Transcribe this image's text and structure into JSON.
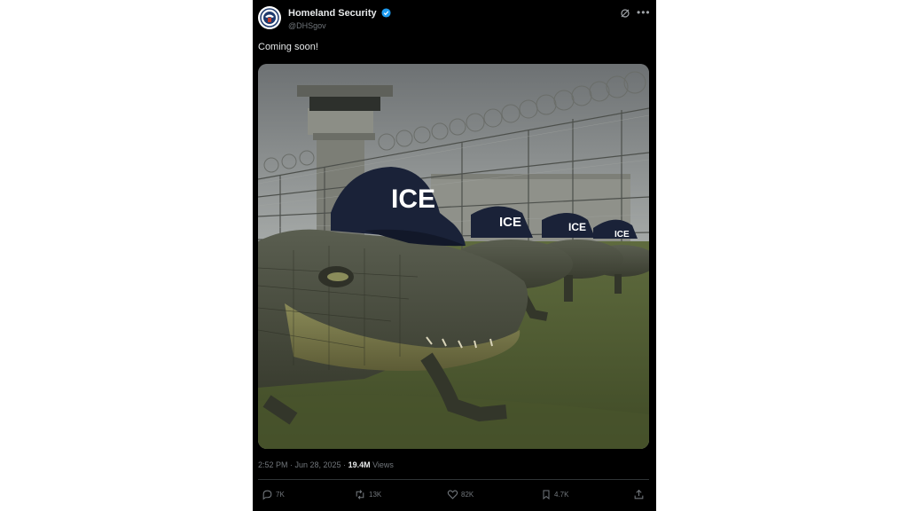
{
  "author": {
    "name": "Homeland Security",
    "handle": "@DHSgov",
    "verified": true,
    "avatar_icon": "dhs-seal-icon"
  },
  "tweet": {
    "text": "Coming soon!",
    "image": {
      "description_icon": "alligators-in-ice-caps-image",
      "hat_label": "ICE"
    }
  },
  "meta": {
    "time": "2:52 PM · Jun 28, 2025 · ",
    "views": "19.4M",
    "views_label": " Views"
  },
  "actions": {
    "replies": "7K",
    "reposts": "13K",
    "likes": "82K",
    "bookmarks": "4.7K"
  },
  "colors": {
    "background": "#000000",
    "text": "#e7e9ea",
    "muted": "#71767b",
    "verified": "#1d9bf0"
  }
}
